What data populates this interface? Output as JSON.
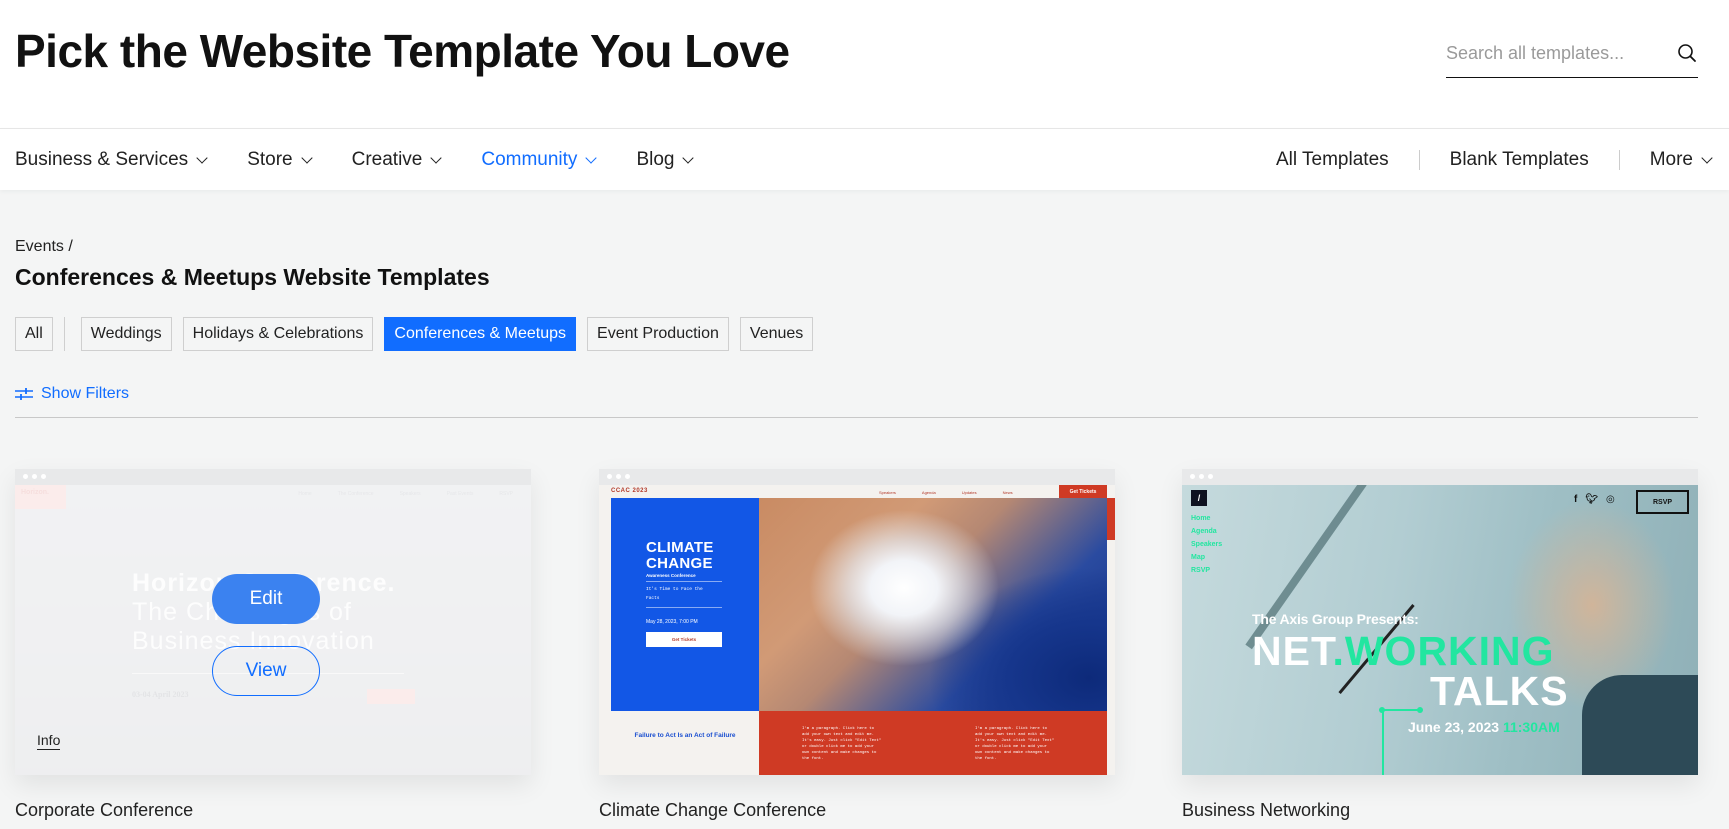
{
  "header": {
    "title": "Pick the Website Template You Love",
    "search_placeholder": "Search all templates..."
  },
  "nav": {
    "left": [
      {
        "label": "Business & Services",
        "active": false
      },
      {
        "label": "Store",
        "active": false
      },
      {
        "label": "Creative",
        "active": false
      },
      {
        "label": "Community",
        "active": true
      },
      {
        "label": "Blog",
        "active": false
      }
    ],
    "right": {
      "all_templates": "All Templates",
      "blank_templates": "Blank Templates",
      "more": "More"
    }
  },
  "breadcrumb": "Events /",
  "section_title": "Conferences & Meetups Website Templates",
  "chips": {
    "all": "All",
    "items": [
      "Weddings",
      "Holidays & Celebrations",
      "Conferences & Meetups",
      "Event Production",
      "Venues"
    ],
    "active": "Conferences & Meetups"
  },
  "show_filters": "Show Filters",
  "colors": {
    "accent": "#116dff",
    "edit_button": "#3b82f0",
    "climate_blue": "#1257e6",
    "climate_red": "#cf3a24",
    "networking_green": "#22e6a0"
  },
  "cards": [
    {
      "name": "Corporate Conference",
      "hover": true,
      "edit_label": "Edit",
      "view_label": "View",
      "info_label": "Info",
      "preview": {
        "logo": "Horizon.",
        "menu": [
          "Home",
          "The Conference",
          "Speakers",
          "Past Events",
          "RSVP"
        ],
        "headline_bold": "Horizon Conference.",
        "headline_line2": "The Challenges of",
        "headline_line3": "Business Innovation",
        "date": "03-04 April 2023",
        "location": "San Francisco",
        "rsvp": "RSVP"
      }
    },
    {
      "name": "Climate Change Conference",
      "preview": {
        "logo": "CCAC 2023",
        "menu": [
          "Speakers",
          "Agenda",
          "Updates",
          "News"
        ],
        "tickets": "Get Tickets",
        "title_line1": "CLIMATE",
        "title_line2": "CHANGE",
        "subtitle": "Awareness Conference",
        "tagline": "It's Time to Face the Facts",
        "date": "May 28, 2023, 7:00 PM",
        "button": "Get Tickets",
        "slogan": "Failure to Act Is an Act of Failure",
        "paragraph": "I'm a paragraph. Click here to add your own text and edit me. It's easy. Just click \"Edit Text\" or double click me to add your own content and make changes to the font."
      }
    },
    {
      "name": "Business Networking",
      "preview": {
        "logo": "/",
        "menu": [
          "Home",
          "Agenda",
          "Speakers",
          "Map",
          "RSVP"
        ],
        "social": [
          "f",
          "t",
          "ig"
        ],
        "rsvp": "RSVP",
        "presents": "The Axis Group Presents:",
        "title_white": "NET",
        "title_green": ".WORKING",
        "title_line2": "TALKS",
        "date": "June 23, 2023",
        "time": "11:30AM"
      }
    }
  ]
}
